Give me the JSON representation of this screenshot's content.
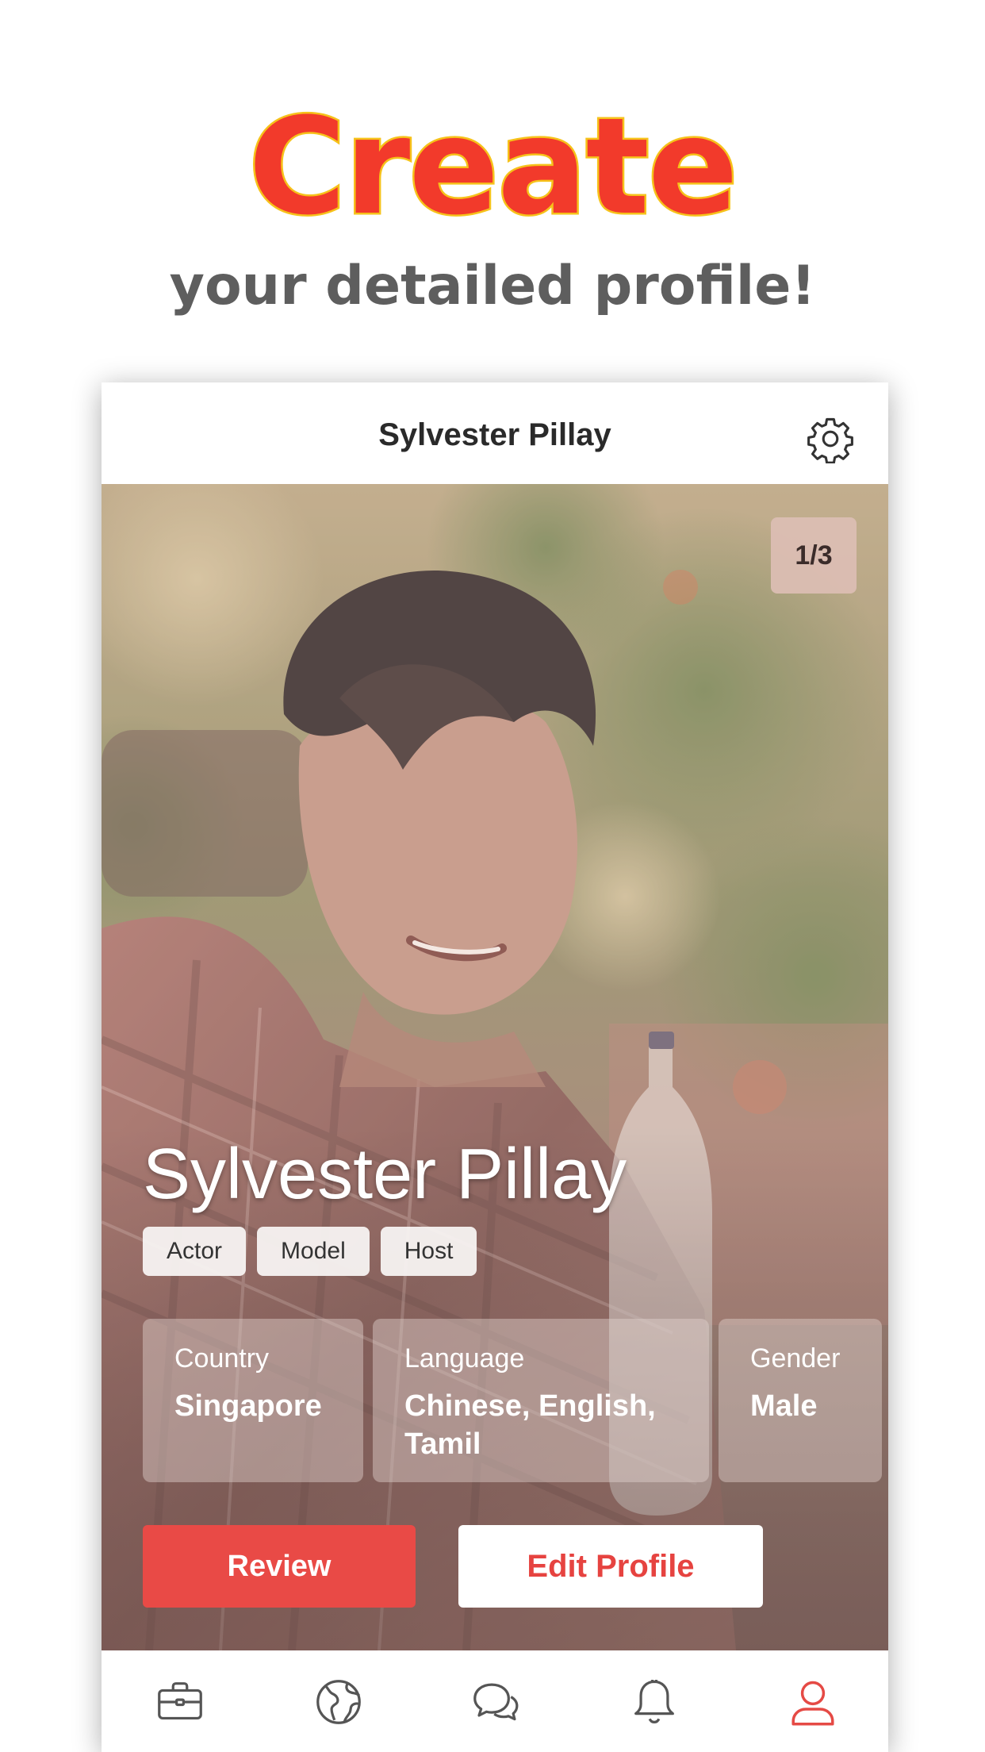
{
  "hero": {
    "title": "Create",
    "subtitle": "your detailed profile!"
  },
  "app": {
    "header_title": "Sylvester Pillay",
    "settings_icon": "gear-icon",
    "photo_counter": "1/3",
    "profile": {
      "name": "Sylvester Pillay",
      "tags": [
        "Actor",
        "Model",
        "Host"
      ],
      "country": {
        "label": "Country",
        "value": "Singapore"
      },
      "language": {
        "label": "Language",
        "value_line1": "Chinese, English,",
        "value_line2": "Tamil"
      },
      "gender": {
        "label": "Gender",
        "value": "Male"
      }
    },
    "actions": {
      "review": "Review",
      "edit_profile": "Edit Profile"
    },
    "tabs": [
      {
        "icon": "briefcase-icon",
        "active": false
      },
      {
        "icon": "globe-icon",
        "active": false
      },
      {
        "icon": "chat-icon",
        "active": false
      },
      {
        "icon": "bell-icon",
        "active": false
      },
      {
        "icon": "user-icon",
        "active": true
      }
    ]
  },
  "colors": {
    "accent_red": "#e94a46",
    "title_red": "#f23a2b",
    "title_outline_yellow": "#f6c21a",
    "inactive_icon": "#555555",
    "active_icon": "#e54a45"
  }
}
